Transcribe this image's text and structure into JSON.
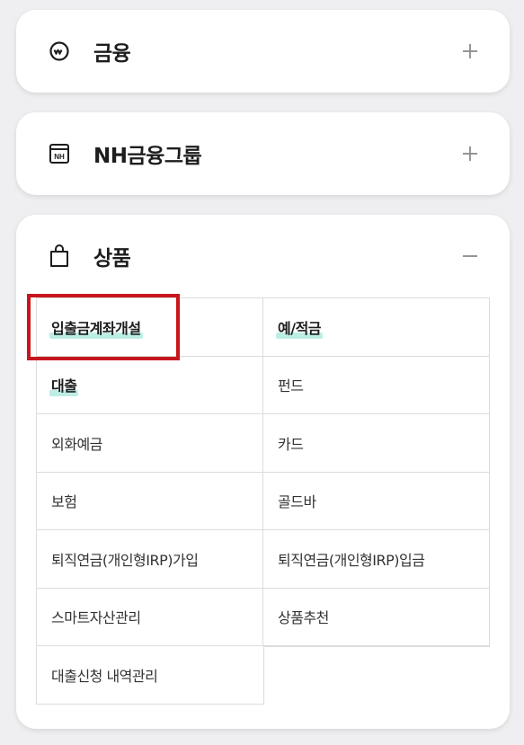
{
  "sections": [
    {
      "icon": "currency-won-icon",
      "title": "금융",
      "toggle": "+"
    },
    {
      "icon": "nh-box-icon",
      "title": "NH금융그룹",
      "toggle": "+"
    },
    {
      "icon": "shopping-bag-icon",
      "title": "상품",
      "toggle": "−"
    }
  ],
  "products": [
    [
      "입출금계좌개설",
      "예/적금"
    ],
    [
      "대출",
      "펀드"
    ],
    [
      "외화예금",
      "카드"
    ],
    [
      "보험",
      "골드바"
    ],
    [
      "퇴직연금(개인형IRP)가입",
      "퇴직연금(개인형IRP)입금"
    ],
    [
      "스마트자산관리",
      "상품추천"
    ],
    [
      "대출신청 내역관리"
    ]
  ],
  "colors": {
    "highlight": "#bdeee6",
    "annotation_box": "#c8161d",
    "background": "#efeff1"
  }
}
